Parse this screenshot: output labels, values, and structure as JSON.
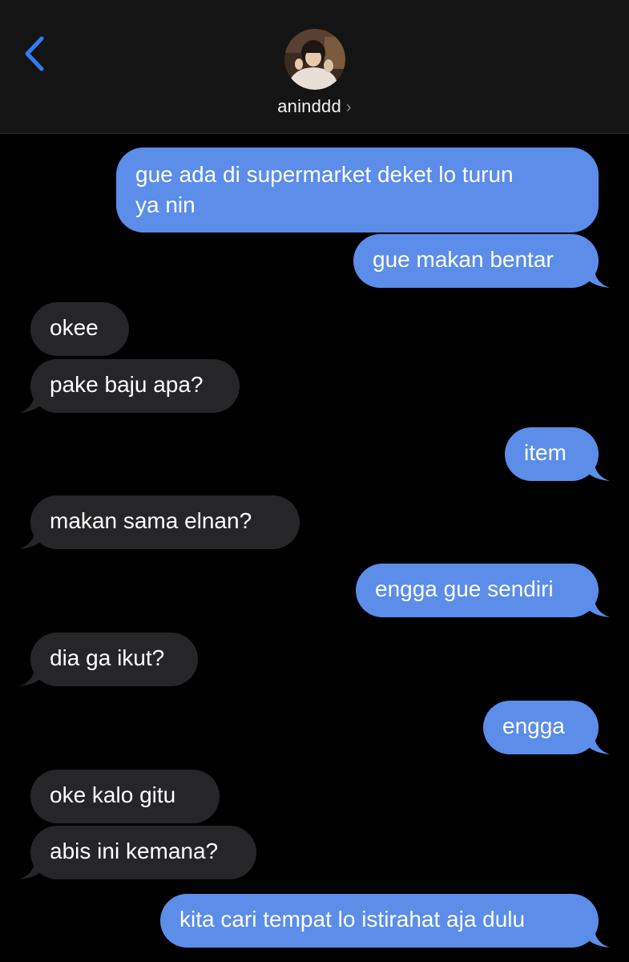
{
  "header": {
    "back_icon": "chevron-left-icon",
    "contact_name": "aninddd",
    "contact_chevron": "›",
    "accent_color": "#2f7cf6"
  },
  "colors": {
    "sent_bubble": "#5b8de9",
    "received_bubble": "#262628",
    "background": "#000000"
  },
  "messages": [
    {
      "side": "sent",
      "text_line1": "gue ada di supermarket deket lo turun",
      "text_line2": "ya nin"
    },
    {
      "side": "sent",
      "text": "gue makan bentar"
    },
    {
      "side": "received",
      "text": "okee"
    },
    {
      "side": "received",
      "text": "pake baju apa?"
    },
    {
      "side": "sent",
      "text": "item"
    },
    {
      "side": "received",
      "text": "makan sama elnan?"
    },
    {
      "side": "sent",
      "text": "engga gue sendiri"
    },
    {
      "side": "received",
      "text": "dia ga ikut?"
    },
    {
      "side": "sent",
      "text": "engga"
    },
    {
      "side": "received",
      "text": "oke kalo gitu"
    },
    {
      "side": "received",
      "text": "abis ini kemana?"
    },
    {
      "side": "sent",
      "text": "kita cari tempat lo istirahat aja dulu"
    }
  ]
}
